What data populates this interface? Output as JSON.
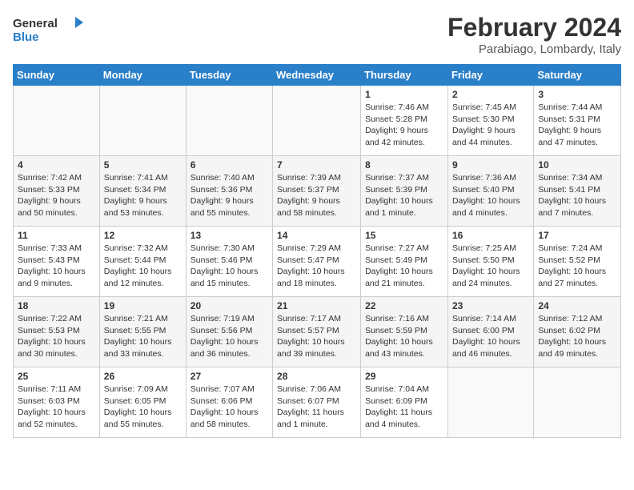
{
  "header": {
    "logo_line1": "General",
    "logo_line2": "Blue",
    "month_year": "February 2024",
    "location": "Parabiago, Lombardy, Italy"
  },
  "weekdays": [
    "Sunday",
    "Monday",
    "Tuesday",
    "Wednesday",
    "Thursday",
    "Friday",
    "Saturday"
  ],
  "weeks": [
    [
      {
        "day": "",
        "info": ""
      },
      {
        "day": "",
        "info": ""
      },
      {
        "day": "",
        "info": ""
      },
      {
        "day": "",
        "info": ""
      },
      {
        "day": "1",
        "info": "Sunrise: 7:46 AM\nSunset: 5:28 PM\nDaylight: 9 hours\nand 42 minutes."
      },
      {
        "day": "2",
        "info": "Sunrise: 7:45 AM\nSunset: 5:30 PM\nDaylight: 9 hours\nand 44 minutes."
      },
      {
        "day": "3",
        "info": "Sunrise: 7:44 AM\nSunset: 5:31 PM\nDaylight: 9 hours\nand 47 minutes."
      }
    ],
    [
      {
        "day": "4",
        "info": "Sunrise: 7:42 AM\nSunset: 5:33 PM\nDaylight: 9 hours\nand 50 minutes."
      },
      {
        "day": "5",
        "info": "Sunrise: 7:41 AM\nSunset: 5:34 PM\nDaylight: 9 hours\nand 53 minutes."
      },
      {
        "day": "6",
        "info": "Sunrise: 7:40 AM\nSunset: 5:36 PM\nDaylight: 9 hours\nand 55 minutes."
      },
      {
        "day": "7",
        "info": "Sunrise: 7:39 AM\nSunset: 5:37 PM\nDaylight: 9 hours\nand 58 minutes."
      },
      {
        "day": "8",
        "info": "Sunrise: 7:37 AM\nSunset: 5:39 PM\nDaylight: 10 hours\nand 1 minute."
      },
      {
        "day": "9",
        "info": "Sunrise: 7:36 AM\nSunset: 5:40 PM\nDaylight: 10 hours\nand 4 minutes."
      },
      {
        "day": "10",
        "info": "Sunrise: 7:34 AM\nSunset: 5:41 PM\nDaylight: 10 hours\nand 7 minutes."
      }
    ],
    [
      {
        "day": "11",
        "info": "Sunrise: 7:33 AM\nSunset: 5:43 PM\nDaylight: 10 hours\nand 9 minutes."
      },
      {
        "day": "12",
        "info": "Sunrise: 7:32 AM\nSunset: 5:44 PM\nDaylight: 10 hours\nand 12 minutes."
      },
      {
        "day": "13",
        "info": "Sunrise: 7:30 AM\nSunset: 5:46 PM\nDaylight: 10 hours\nand 15 minutes."
      },
      {
        "day": "14",
        "info": "Sunrise: 7:29 AM\nSunset: 5:47 PM\nDaylight: 10 hours\nand 18 minutes."
      },
      {
        "day": "15",
        "info": "Sunrise: 7:27 AM\nSunset: 5:49 PM\nDaylight: 10 hours\nand 21 minutes."
      },
      {
        "day": "16",
        "info": "Sunrise: 7:25 AM\nSunset: 5:50 PM\nDaylight: 10 hours\nand 24 minutes."
      },
      {
        "day": "17",
        "info": "Sunrise: 7:24 AM\nSunset: 5:52 PM\nDaylight: 10 hours\nand 27 minutes."
      }
    ],
    [
      {
        "day": "18",
        "info": "Sunrise: 7:22 AM\nSunset: 5:53 PM\nDaylight: 10 hours\nand 30 minutes."
      },
      {
        "day": "19",
        "info": "Sunrise: 7:21 AM\nSunset: 5:55 PM\nDaylight: 10 hours\nand 33 minutes."
      },
      {
        "day": "20",
        "info": "Sunrise: 7:19 AM\nSunset: 5:56 PM\nDaylight: 10 hours\nand 36 minutes."
      },
      {
        "day": "21",
        "info": "Sunrise: 7:17 AM\nSunset: 5:57 PM\nDaylight: 10 hours\nand 39 minutes."
      },
      {
        "day": "22",
        "info": "Sunrise: 7:16 AM\nSunset: 5:59 PM\nDaylight: 10 hours\nand 43 minutes."
      },
      {
        "day": "23",
        "info": "Sunrise: 7:14 AM\nSunset: 6:00 PM\nDaylight: 10 hours\nand 46 minutes."
      },
      {
        "day": "24",
        "info": "Sunrise: 7:12 AM\nSunset: 6:02 PM\nDaylight: 10 hours\nand 49 minutes."
      }
    ],
    [
      {
        "day": "25",
        "info": "Sunrise: 7:11 AM\nSunset: 6:03 PM\nDaylight: 10 hours\nand 52 minutes."
      },
      {
        "day": "26",
        "info": "Sunrise: 7:09 AM\nSunset: 6:05 PM\nDaylight: 10 hours\nand 55 minutes."
      },
      {
        "day": "27",
        "info": "Sunrise: 7:07 AM\nSunset: 6:06 PM\nDaylight: 10 hours\nand 58 minutes."
      },
      {
        "day": "28",
        "info": "Sunrise: 7:06 AM\nSunset: 6:07 PM\nDaylight: 11 hours\nand 1 minute."
      },
      {
        "day": "29",
        "info": "Sunrise: 7:04 AM\nSunset: 6:09 PM\nDaylight: 11 hours\nand 4 minutes."
      },
      {
        "day": "",
        "info": ""
      },
      {
        "day": "",
        "info": ""
      }
    ]
  ]
}
